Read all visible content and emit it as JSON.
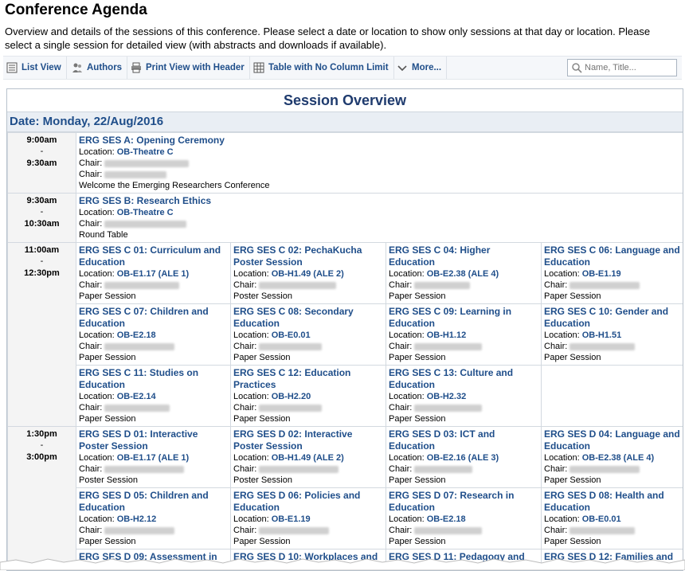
{
  "page": {
    "title": "Conference Agenda",
    "intro": "Overview and details of the sessions of this conference. Please select a date or location to show only sessions at that day or location. Please select a single session for detailed view (with abstracts and downloads if available)."
  },
  "toolbar": {
    "list_view": "List View",
    "authors": "Authors",
    "print_view": "Print View with Header",
    "table_view": "Table with No Column Limit",
    "more": "More...",
    "search_placeholder": "Name, Title..."
  },
  "overview": {
    "title": "Session Overview",
    "date": "Date: Monday, 22/Aug/2016"
  },
  "labels": {
    "location": "Location: ",
    "chair": "Chair: ",
    "dash": "-"
  },
  "slots": [
    {
      "start": "9:00am",
      "end": "9:30am",
      "sessions": [
        {
          "title": "ERG SES A: Opening Ceremony",
          "location": "OB-Theatre C",
          "chairs": 2,
          "note": "Welcome the Emerging Researchers Conference"
        }
      ]
    },
    {
      "start": "9:30am",
      "end": "10:30am",
      "sessions": [
        {
          "title": "ERG SES B: Research Ethics",
          "location": "OB-Theatre C",
          "chairs": 1,
          "note": "Round Table"
        }
      ]
    },
    {
      "start": "11:00am",
      "end": "12:30pm",
      "rows": [
        [
          {
            "title": "ERG SES C 01: Curriculum and Education",
            "location": "OB-E1.17 (ALE 1)",
            "chairs": 1,
            "note": "Paper Session"
          },
          {
            "title": "ERG SES C 02: PechaKucha Poster Session",
            "location": "OB-H1.49 (ALE 2)",
            "chairs": 1,
            "note": "Poster Session"
          },
          {
            "title": "ERG SES C 04: Higher Education",
            "location": "OB-E2.38 (ALE 4)",
            "chairs": 1,
            "note": "Paper Session"
          },
          {
            "title": "ERG SES C 06: Language and Education",
            "location": "OB-E1.19",
            "chairs": 1,
            "note": "Paper Session"
          }
        ],
        [
          {
            "title": "ERG SES C 07: Children and Education",
            "location": "OB-E2.18",
            "chairs": 1,
            "note": "Paper Session"
          },
          {
            "title": "ERG SES C 08: Secondary Education",
            "location": "OB-E0.01",
            "chairs": 1,
            "note": "Paper Session"
          },
          {
            "title": "ERG SES C 09: Learning in Education",
            "location": "OB-H1.12",
            "chairs": 1,
            "note": "Paper Session"
          },
          {
            "title": "ERG SES C 10: Gender and Education",
            "location": "OB-H1.51",
            "chairs": 1,
            "note": "Paper Session"
          }
        ],
        [
          {
            "title": "ERG SES C 11: Studies on Education",
            "location": "OB-E2.14",
            "chairs": 1,
            "note": "Paper Session"
          },
          {
            "title": "ERG SES C 12: Education Practices",
            "location": "OB-H2.20",
            "chairs": 1,
            "note": "Paper Session"
          },
          {
            "title": "ERG SES C 13: Culture and Education",
            "location": "OB-H2.32",
            "chairs": 1,
            "note": "Paper Session"
          }
        ]
      ]
    },
    {
      "start": "1:30pm",
      "end": "3:00pm",
      "rows": [
        [
          {
            "title": "ERG SES D 01: Interactive Poster Session",
            "location": "OB-E1.17 (ALE 1)",
            "chairs": 1,
            "note": "Poster Session"
          },
          {
            "title": "ERG SES D 02: Interactive Poster Session",
            "location": "OB-H1.49 (ALE 2)",
            "chairs": 1,
            "note": "Poster Session"
          },
          {
            "title": "ERG SES D 03: ICT and Education",
            "location": "OB-E2.16 (ALE 3)",
            "chairs": 1,
            "note": "Paper Session"
          },
          {
            "title": "ERG SES D 04: Language and Education",
            "location": "OB-E2.38 (ALE 4)",
            "chairs": 1,
            "note": "Paper Session"
          }
        ],
        [
          {
            "title": "ERG SES D 05: Children and Education",
            "location": "OB-H2.12",
            "chairs": 1,
            "note": "Paper Session"
          },
          {
            "title": "ERG SES D 06: Policies and Education",
            "location": "OB-E1.19",
            "chairs": 1,
            "note": "Paper Session"
          },
          {
            "title": "ERG SES D 07: Research in Education",
            "location": "OB-E2.18",
            "chairs": 1,
            "note": "Paper Session"
          },
          {
            "title": "ERG SES D 08: Health and Education",
            "location": "OB-E0.01",
            "chairs": 1,
            "note": "Paper Session"
          }
        ],
        [
          {
            "title": "ERG SES D 09: Assessment in",
            "location": "",
            "chairs": 0,
            "note": ""
          },
          {
            "title": "ERG SES D 10: Workplaces and",
            "location": "",
            "chairs": 0,
            "note": ""
          },
          {
            "title": "ERG SES D 11: Pedagogy and",
            "location": "",
            "chairs": 0,
            "note": ""
          },
          {
            "title": "ERG SES D 12: Families and",
            "location": "",
            "chairs": 0,
            "note": ""
          }
        ]
      ]
    }
  ],
  "colors": {
    "link": "#1f4e8a",
    "heading": "#1f3b6e",
    "date_bar": "#e9eef4"
  }
}
